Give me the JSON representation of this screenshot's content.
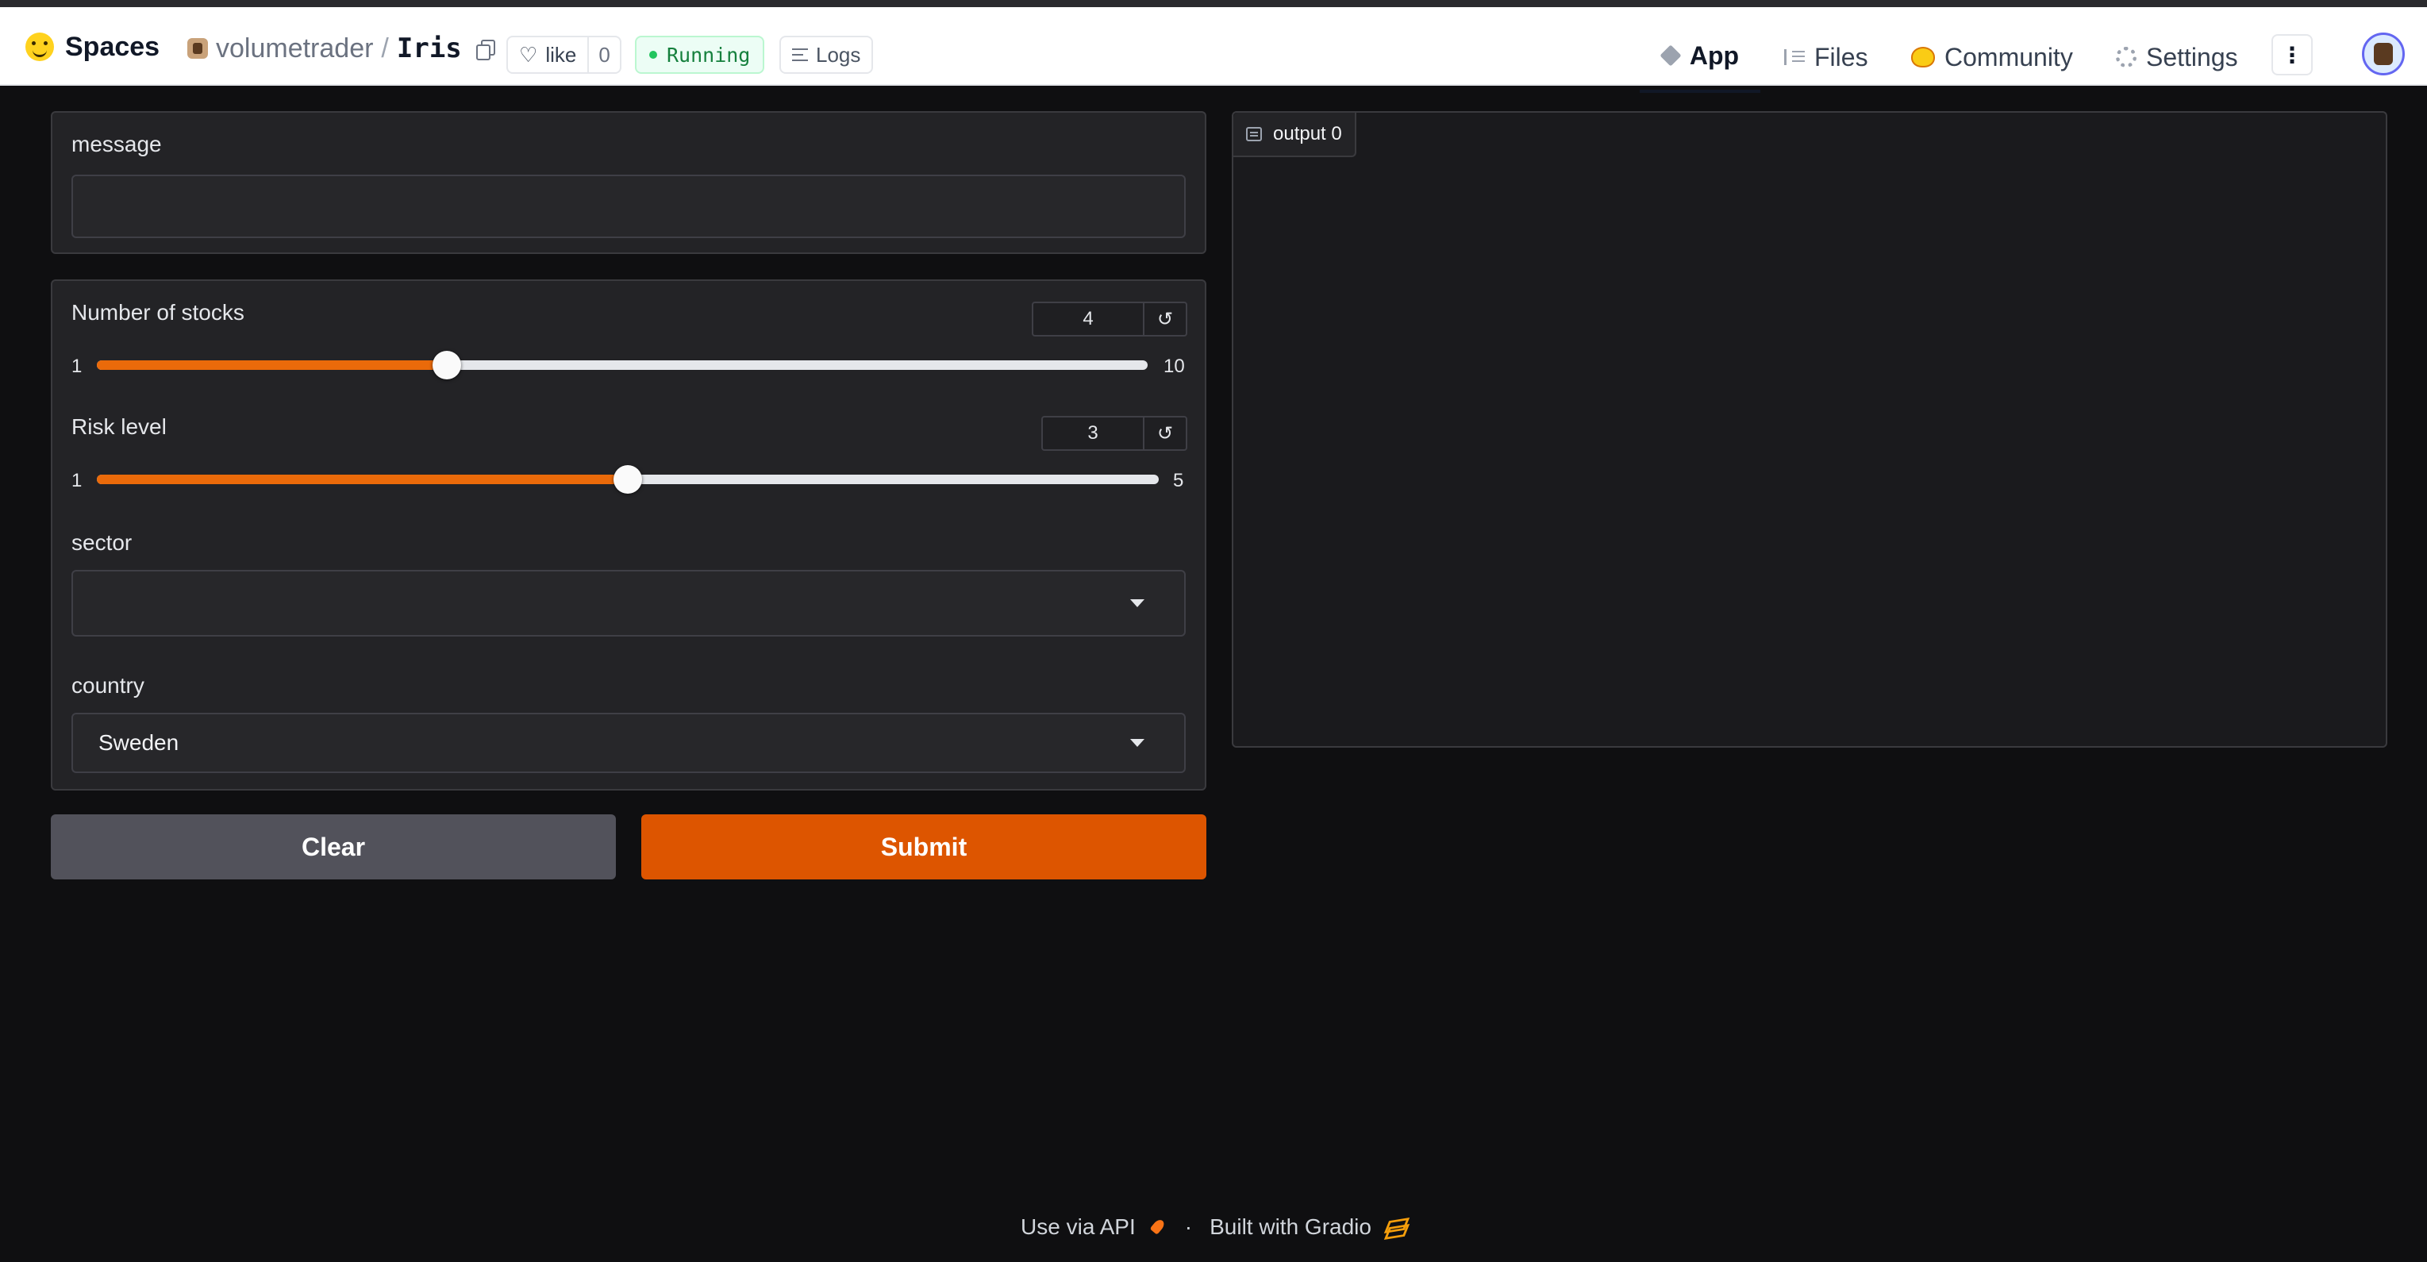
{
  "header": {
    "spaces_label": "Spaces",
    "owner": "volumetrader",
    "separator": "/",
    "repo": "Iris",
    "like_label": "like",
    "like_count": "0",
    "status": "Running",
    "logs_label": "Logs",
    "nav": {
      "app": "App",
      "files": "Files",
      "community": "Community",
      "settings": "Settings"
    },
    "more_label": "⋮"
  },
  "form": {
    "message": {
      "label": "message",
      "value": ""
    },
    "stocks": {
      "label": "Number of stocks",
      "value": "4",
      "min": "1",
      "max": "10",
      "fraction": 0.333,
      "reset": "↺"
    },
    "risk": {
      "label": "Risk level",
      "value": "3",
      "min": "1",
      "max": "5",
      "fraction": 0.5,
      "reset": "↺"
    },
    "sector": {
      "label": "sector",
      "value": ""
    },
    "country": {
      "label": "country",
      "value": "Sweden"
    }
  },
  "buttons": {
    "clear": "Clear",
    "submit": "Submit"
  },
  "output": {
    "tag": "output 0"
  },
  "footer": {
    "api": "Use via API",
    "dot": "·",
    "built": "Built with Gradio"
  },
  "colors": {
    "accent": "#ea6a0a",
    "submit": "#dd5500",
    "clear": "#52525b",
    "bg": "#0f0f11"
  }
}
